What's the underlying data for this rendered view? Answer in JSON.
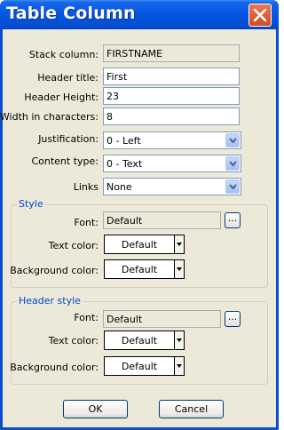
{
  "window": {
    "title": "Table Column"
  },
  "fields": {
    "stack_column": {
      "label": "Stack column:",
      "value": "FIRSTNAME"
    },
    "header_title": {
      "label": "Header title:",
      "value": "First"
    },
    "header_height": {
      "label": "Header Height:",
      "value": "23"
    },
    "width_chars": {
      "label": "Width in characters:",
      "value": "8"
    },
    "justification": {
      "label": "Justification:",
      "value": "0 - Left"
    },
    "content_type": {
      "label": "Content type:",
      "value": "0 - Text"
    },
    "links": {
      "label": "Links",
      "value": "None"
    }
  },
  "style": {
    "title": "Style",
    "font_label": "Font:",
    "font_value": "Default",
    "text_color_label": "Text color:",
    "text_color_value": "Default",
    "bg_color_label": "Background color:",
    "bg_color_value": "Default",
    "ellipsis": "..."
  },
  "header_style": {
    "title": "Header style",
    "font_label": "Font:",
    "font_value": "Default",
    "text_color_label": "Text color:",
    "text_color_value": "Default",
    "bg_color_label": "Background color:",
    "bg_color_value": "Default",
    "ellipsis": "..."
  },
  "buttons": {
    "ok": "OK",
    "cancel": "Cancel"
  },
  "colors": {
    "titlebar": "#0558e4",
    "close": "#d24b24",
    "group_title": "#0046d5",
    "client": "#ece9d8"
  }
}
